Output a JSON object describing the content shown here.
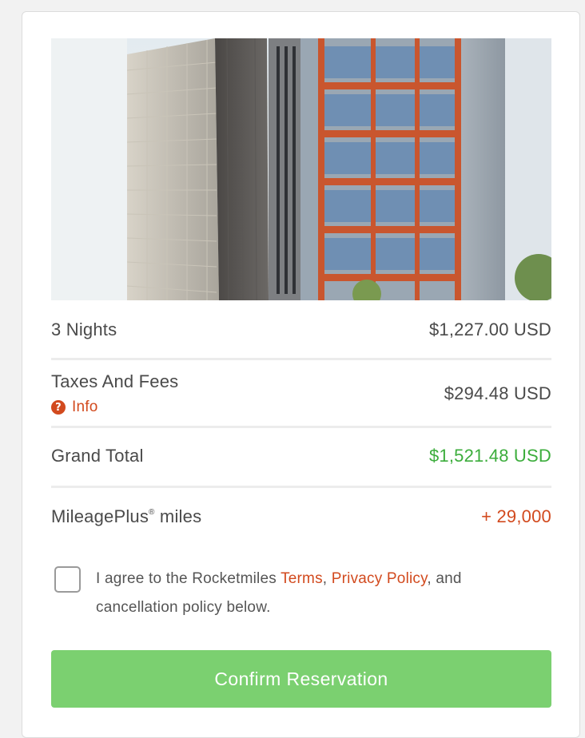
{
  "summary": {
    "nights_label": "3 Nights",
    "nights_price": "$1,227.00 USD",
    "taxes_label": "Taxes And Fees",
    "info_label": "Info",
    "taxes_price": "$294.48 USD",
    "total_label": "Grand Total",
    "total_price": "$1,521.48 USD",
    "miles_label": "MileagePlus",
    "miles_reg": "®",
    "miles_suffix": " miles",
    "miles_value": "+ 29,000"
  },
  "agreement": {
    "prefix": "I agree to the Rocketmiles ",
    "terms_link": "Terms",
    "separator": ", ",
    "privacy_link": "Privacy Policy",
    "suffix": ", and cancellation policy below."
  },
  "actions": {
    "confirm_label": "Confirm Reservation"
  },
  "colors": {
    "accent_orange": "#d24a1e",
    "total_green": "#3cad3c",
    "button_green": "#7bd070"
  },
  "icons": {
    "info": "question-circle-icon"
  }
}
